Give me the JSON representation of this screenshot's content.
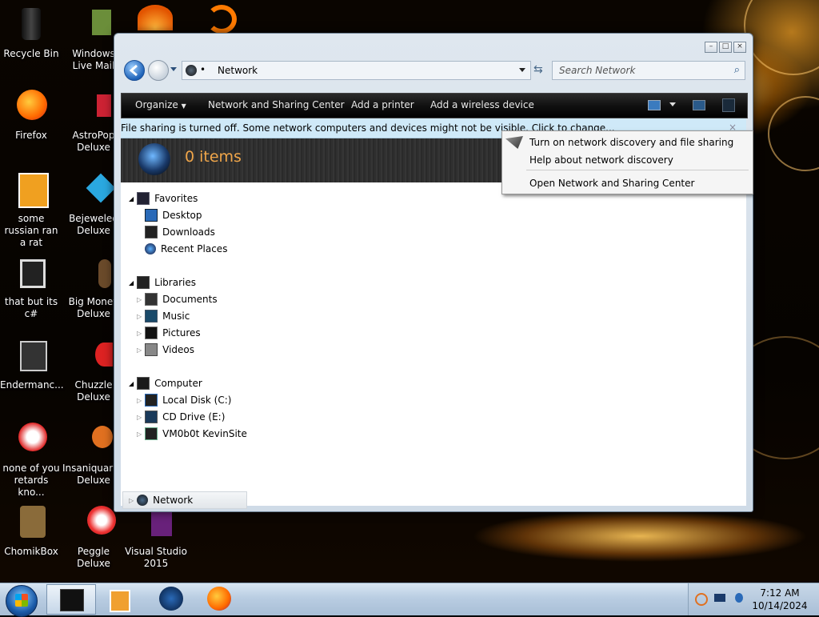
{
  "desktop": {
    "icons": [
      {
        "label": "Recycle Bin",
        "icon": "recycle-bin-icon"
      },
      {
        "label": "Windows Live Mail",
        "icon": "mail-icon"
      },
      {
        "label": "Firefox",
        "icon": "firefox-icon"
      },
      {
        "label": "AstroPop Deluxe",
        "icon": "astropop-icon"
      },
      {
        "label": "some russian ran a rat",
        "icon": "folder-icon"
      },
      {
        "label": "Bejeweled Deluxe",
        "icon": "bejeweled-icon"
      },
      {
        "label": "that but its c#",
        "icon": "shortcut-icon"
      },
      {
        "label": "Big Money Deluxe",
        "icon": "big-money-icon"
      },
      {
        "label": "Endermanc...",
        "icon": "video-file-icon"
      },
      {
        "label": "Chuzzle Deluxe",
        "icon": "chuzzle-icon"
      },
      {
        "label": "none of you retards kno...",
        "icon": "app-icon"
      },
      {
        "label": "Insaniquarium Deluxe",
        "icon": "insaniquarium-icon"
      },
      {
        "label": "ChomikBox",
        "icon": "chomikbox-icon"
      },
      {
        "label": "Peggle Deluxe",
        "icon": "peggle-icon"
      },
      {
        "label": "Visual Studio 2015",
        "icon": "visual-studio-icon"
      }
    ]
  },
  "window": {
    "address": "Network",
    "search_placeholder": "Search Network",
    "toolbar": {
      "organize": "Organize",
      "network_sharing": "Network and Sharing Center",
      "add_printer": "Add a printer",
      "add_wireless": "Add a wireless device"
    },
    "infobar": {
      "text": "File sharing is turned off. Some network computers and devices might not be visible. Click to change...",
      "close": "×"
    },
    "header": {
      "count_text": "0 items"
    },
    "tree": {
      "favorites": {
        "label": "Favorites",
        "items": [
          "Desktop",
          "Downloads",
          "Recent Places"
        ]
      },
      "libraries": {
        "label": "Libraries",
        "items": [
          "Documents",
          "Music",
          "Pictures",
          "Videos"
        ]
      },
      "computer": {
        "label": "Computer",
        "items": [
          "Local Disk (C:)",
          "CD Drive (E:)",
          "VM0b0t KevinSite"
        ]
      },
      "network": {
        "label": "Network"
      }
    }
  },
  "context_menu": {
    "items": [
      "Turn on network discovery and file sharing",
      "Help about network discovery",
      "Open Network and Sharing Center"
    ]
  },
  "taskbar": {
    "clock_time": "7:12 AM",
    "clock_date": "10/14/2024"
  }
}
